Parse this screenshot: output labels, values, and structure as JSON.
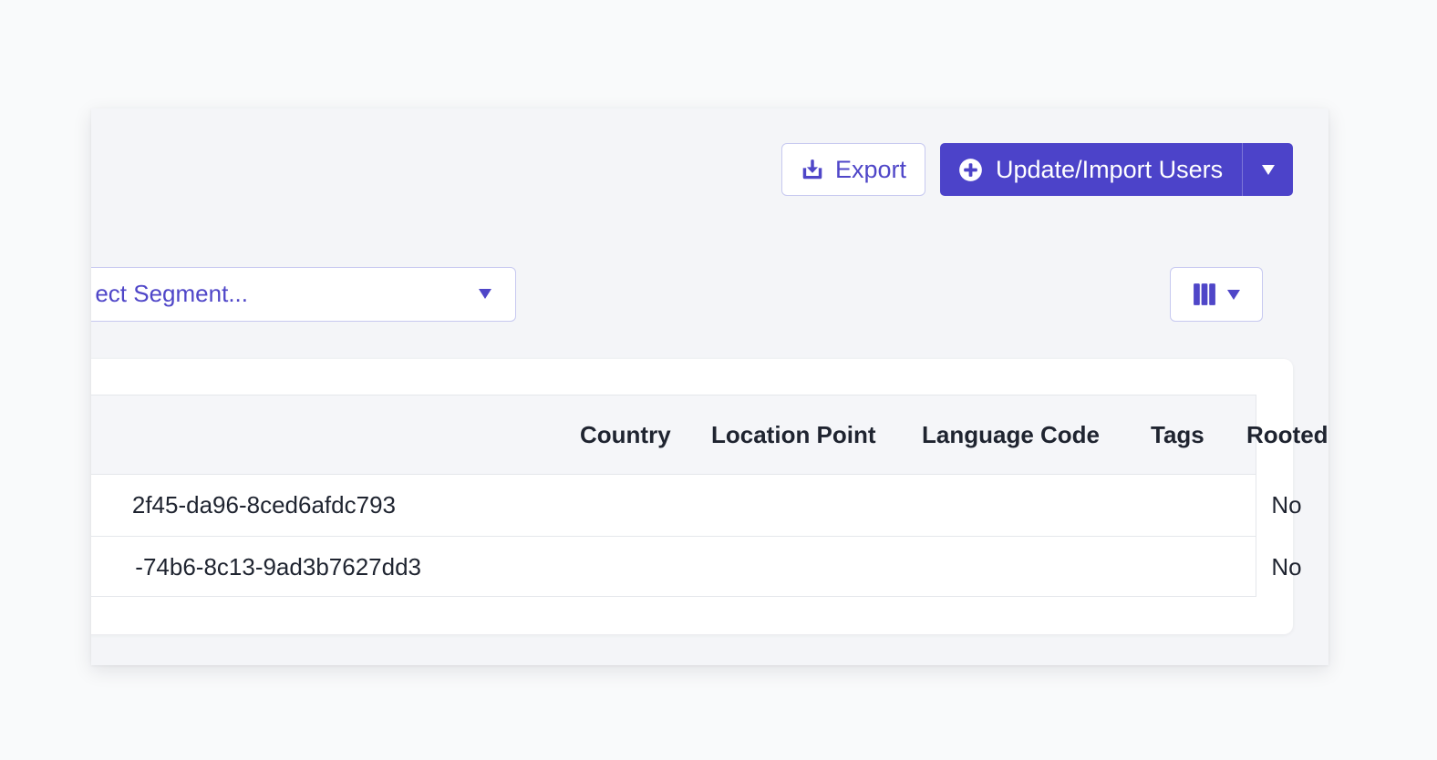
{
  "header": {
    "export_label": "Export",
    "export_icon": "download-icon",
    "update_label": "Update/Import Users",
    "update_icon": "plus-circle-icon",
    "update_dropdown_icon": "caret-down-icon"
  },
  "filters": {
    "segment_placeholder": "Select Segment...",
    "segment_visible_text": "ect Segment...",
    "columns_icon": "columns-icon"
  },
  "table": {
    "columns": [
      "Country",
      "Location Point",
      "Language Code",
      "Tags",
      "Rooted"
    ],
    "rows": [
      {
        "id": "2f45-da96-8ced6afdc793",
        "country": "",
        "location_point": "",
        "language_code": "",
        "tags": "",
        "rooted": "No"
      },
      {
        "id": "-74b6-8c13-9ad3b7627dd3",
        "country": "",
        "location_point": "",
        "language_code": "",
        "tags": "",
        "rooted": "No"
      }
    ]
  },
  "colors": {
    "accent": "#4c43c9",
    "accent_text": "#4f46c8",
    "border": "#c7c9f0",
    "page_bg": "#f9fafb",
    "panel_bg": "#f4f5f8",
    "header_bg": "#f5f6f9",
    "text": "#1f2430"
  }
}
